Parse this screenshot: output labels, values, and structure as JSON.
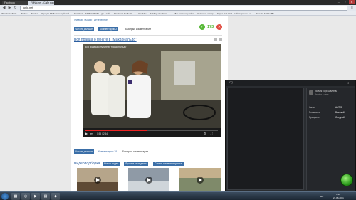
{
  "browser": {
    "tabs": [
      "Facebook",
      "FUNki.net - Сайт хорошег..."
    ],
    "url": "funki.net",
    "bookmarks": [
      "Wonderful Tools",
      "Mobile",
      "Mocha",
      "Одежда EFT",
      "Порхающий мой...",
      "Facebook",
      "FAMFAMFAM",
      "gfx - сайт",
      "Elektronic Radio Wi...",
      "YouTube",
      "Building / SoftMax...",
      "«Бог слов над Тайм...",
      "Новости - смотр...",
      "Super Hub LAB",
      "Сайт хорошего на...",
      "Ebooks Archive/Bo..."
    ]
  },
  "page": {
    "breadcrumb": "Главная / Юмор / Интересное",
    "buttons": {
      "read_more": "Читать дальше",
      "comments": "Комментарии 2",
      "quick_comments": "Быстрые комментарии"
    },
    "likes": "173",
    "post_title": "Вся правда о пункте в \"Макдональдс\"",
    "video_title": "Вся правда о пункте в \"Макдональдс\"",
    "player_time": "0:55 / 2:54",
    "player_progress": 0.47,
    "comment_tabs": {
      "read_more": "Читать дальше",
      "comments": "Комментарии 1/9",
      "quick": "Быстрые комментарии"
    },
    "videos_section": "Видеоподборка",
    "video_filters": [
      "Новое видео",
      "Лучшее за неделю",
      "Самые комментируемые"
    ]
  },
  "app": {
    "title": "ICQ",
    "contact_name": "Зайчик Торгашвлитва",
    "contact_status": "Зашёл в сеть",
    "labels": [
      "Канал",
      "Громкость",
      "Приоритет"
    ],
    "values": [
      "ANTiS",
      "Высокий",
      "Средний"
    ]
  },
  "taskbar": {
    "time": "4:41",
    "date": "21.06.2011",
    "lang": "RU"
  }
}
